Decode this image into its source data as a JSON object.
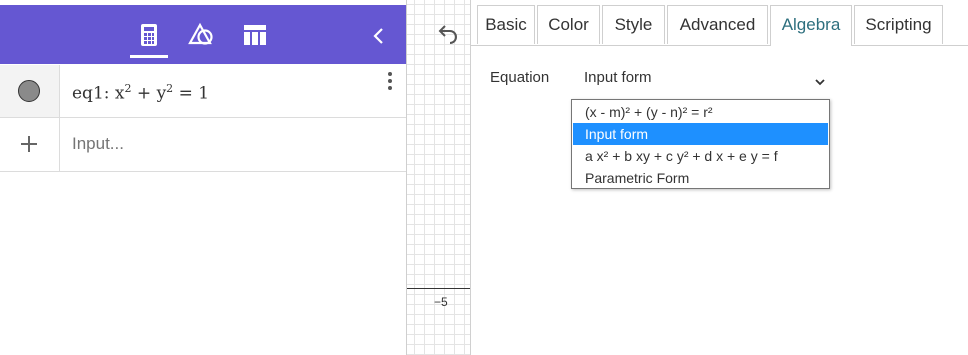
{
  "algebra": {
    "equation": {
      "name": "eq1:",
      "x": "x",
      "exp": "2",
      "plus": "+",
      "y": "y",
      "equals": "=",
      "rhs": "1"
    },
    "input_placeholder": "Input..."
  },
  "graphics": {
    "axis_tick_label": "−5"
  },
  "properties": {
    "tabs": [
      {
        "label": "Basic"
      },
      {
        "label": "Color"
      },
      {
        "label": "Style"
      },
      {
        "label": "Advanced"
      },
      {
        "label": "Algebra"
      },
      {
        "label": "Scripting"
      }
    ],
    "active_tab": "Algebra",
    "equation_label": "Equation",
    "equation_value": "Input form",
    "options": [
      {
        "label": "(x - m)² + (y - n)² = r²",
        "selected": false
      },
      {
        "label": "Input form",
        "selected": true
      },
      {
        "label": "a x² + b xy + c y² + d x + e y = f",
        "selected": false
      },
      {
        "label": "Parametric Form",
        "selected": false
      }
    ]
  },
  "colors": {
    "header_bg": "#6557d2",
    "active_tab_text": "#2d6f7e",
    "selected_option_bg": "#1e90ff",
    "point_fill": "#8a8a8a"
  }
}
